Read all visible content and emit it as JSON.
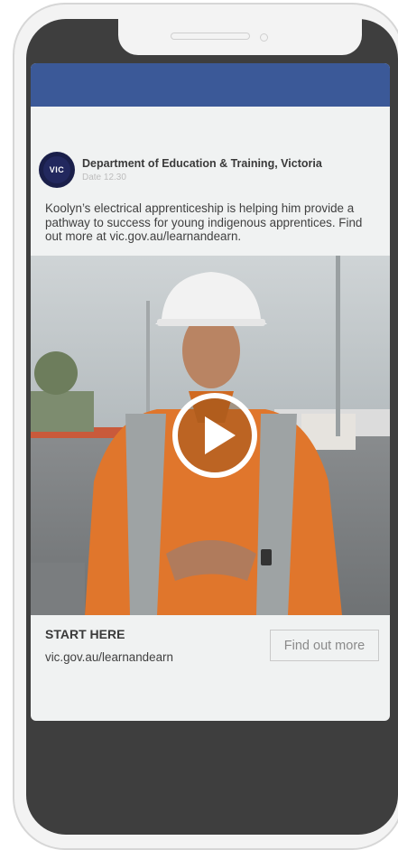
{
  "post": {
    "page_name": "Department of Education & Training, Victoria",
    "date": "Date 12.30",
    "avatar_text": "VIC",
    "text": "Koolyn’s electrical apprenticeship is helping him provide a pathway to success for young indigenous apprentices. Find out more at vic.gov.au/learnandearn."
  },
  "video": {
    "play_icon": "play-icon"
  },
  "cta": {
    "heading": "START HERE",
    "url": "vic.gov.au/learnandearn",
    "button_label": "Find out more"
  },
  "colors": {
    "top_bar": "#3b5998",
    "phone_body": "#3e3e3e",
    "screen_bg": "#f0f2f2"
  }
}
